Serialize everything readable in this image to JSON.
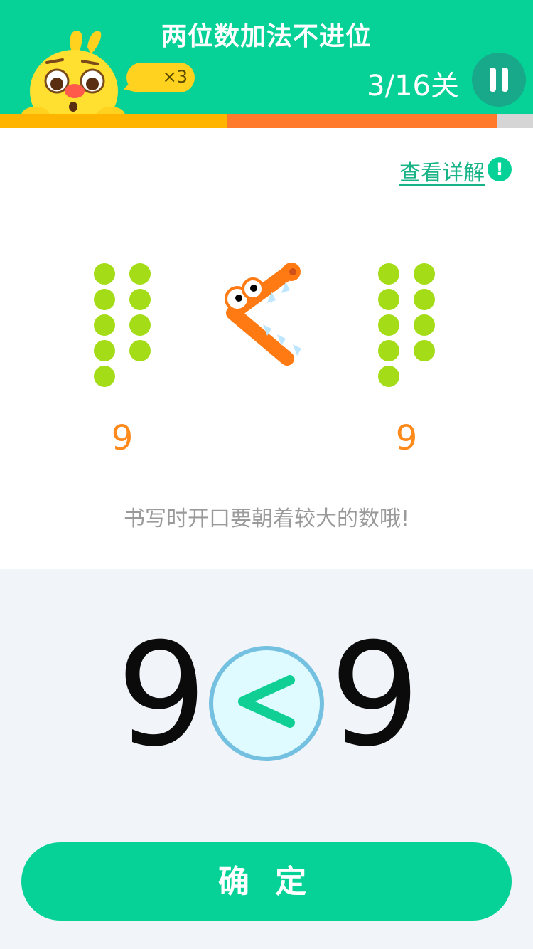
{
  "header": {
    "title": "两位数加法不进位",
    "level": "3/16关",
    "lives": "×3"
  },
  "progress": {
    "completed_fraction": 0.427,
    "current_fraction": 0.933
  },
  "colors": {
    "brand_green": "#06d298",
    "dot_green": "#a4dd17",
    "number_orange": "#ff8a1c",
    "progress_done": "#ffb400",
    "progress_current": "#ff7a2b"
  },
  "detail": {
    "link_label": "查看详解",
    "icon_glyph": "!"
  },
  "comparison": {
    "left_count_label": "9",
    "right_count_label": "9",
    "left_dot_count": 9,
    "right_dot_count": 9,
    "hint": "书写时开口要朝着较大的数哦!"
  },
  "answer": {
    "left_number": "9",
    "right_number": "9",
    "selected_symbol": "<"
  },
  "confirm_button": "确 定"
}
